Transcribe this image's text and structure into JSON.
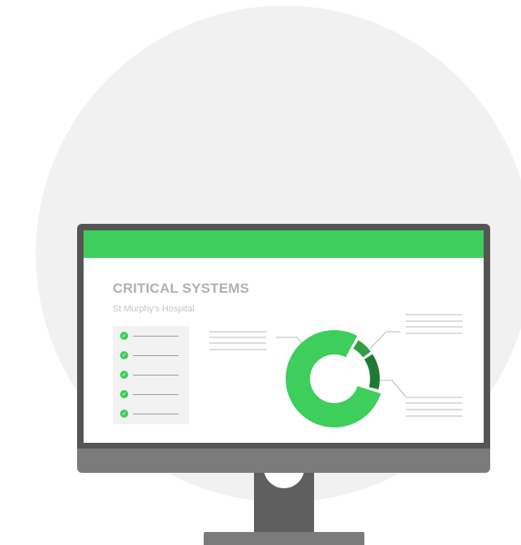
{
  "screen": {
    "title": "CRITICAL SYSTEMS",
    "subtitle": "St Murphy's Hospital"
  },
  "checklist": {
    "item_count": 5,
    "icon": "check-circle-icon"
  },
  "donut": {
    "segments": [
      {
        "share": 0.79,
        "color": "#3dce5b"
      },
      {
        "share": 0.07,
        "color": "#2f9e45"
      },
      {
        "share": 0.14,
        "color": "#1f7a33"
      }
    ]
  },
  "colors": {
    "accent": "#3dce5b",
    "accent_dark": "#2f9e45",
    "accent_darker": "#1f7a33",
    "bezel": "#555555",
    "chin": "#7b7b7b",
    "background_circle": "#f1f1f1"
  }
}
